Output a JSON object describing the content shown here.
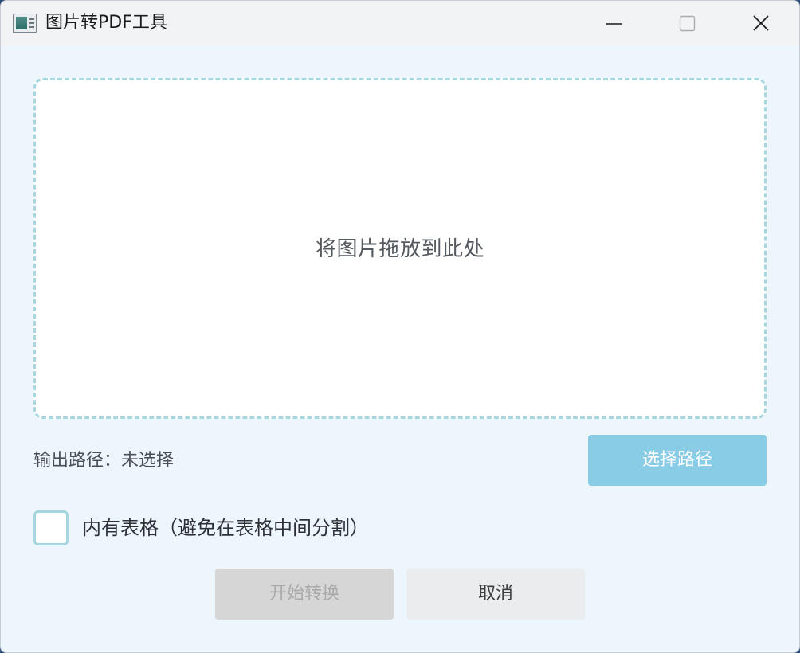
{
  "window": {
    "title": "图片转PDF工具",
    "controls": [
      "minimize-icon",
      "maximize-icon",
      "close-icon"
    ]
  },
  "drop_zone": {
    "text": "将图片拖放到此处"
  },
  "output": {
    "label": "输出路径：未选择",
    "select_button": "选择路径"
  },
  "options": {
    "table_checkbox_label": "内有表格（避免在表格中间分割）",
    "table_checkbox_checked": false
  },
  "actions": {
    "start_button": "开始转换",
    "start_enabled": false,
    "cancel_button": "取消"
  },
  "colors": {
    "accent": "#88cce6",
    "dashed_border": "#a8d6e0",
    "window_bg": "#eef6fd",
    "disabled_button": "#d6d6d6"
  }
}
